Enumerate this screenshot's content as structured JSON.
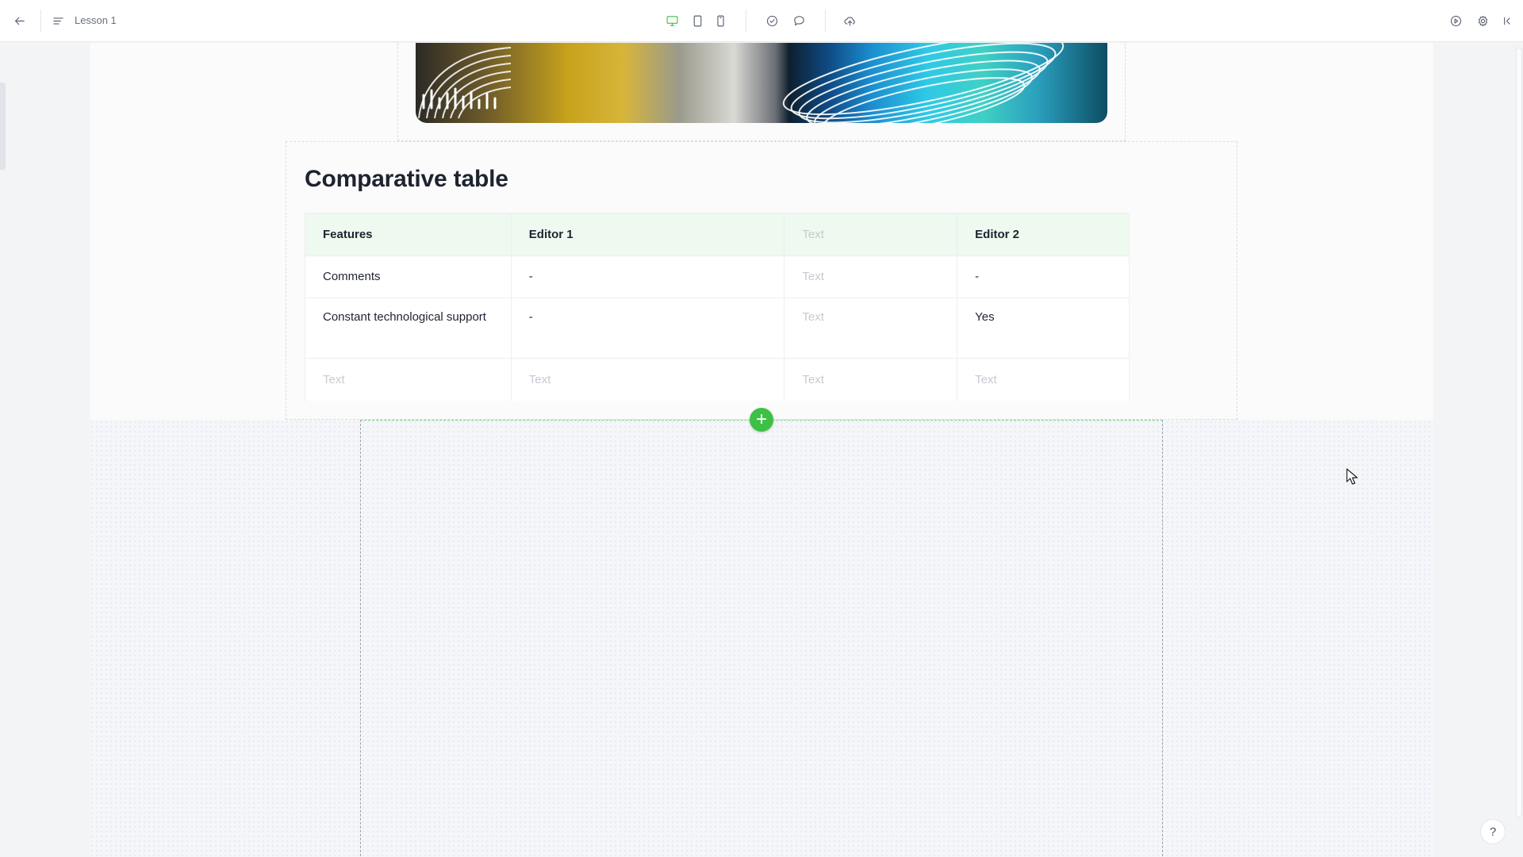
{
  "header": {
    "lesson_title": "Lesson 1",
    "back_icon": "arrow-left-icon",
    "menu_icon": "outline-menu-icon",
    "devices": [
      "desktop-icon",
      "tablet-icon",
      "mobile-icon"
    ],
    "active_device": "desktop",
    "accent_color": "#3ec046"
  },
  "content": {
    "table_title": "Comparative table",
    "table": {
      "headers": [
        "Features",
        "Editor 1",
        "Text",
        "Editor 2"
      ],
      "rows": [
        [
          "Comments",
          "-",
          "Text",
          "-"
        ],
        [
          "Constant technological support",
          "-",
          "Text",
          "Yes"
        ],
        [
          "Text",
          "Text",
          "Text",
          "Text"
        ]
      ]
    },
    "add_block_label": "+"
  },
  "help_label": "?"
}
